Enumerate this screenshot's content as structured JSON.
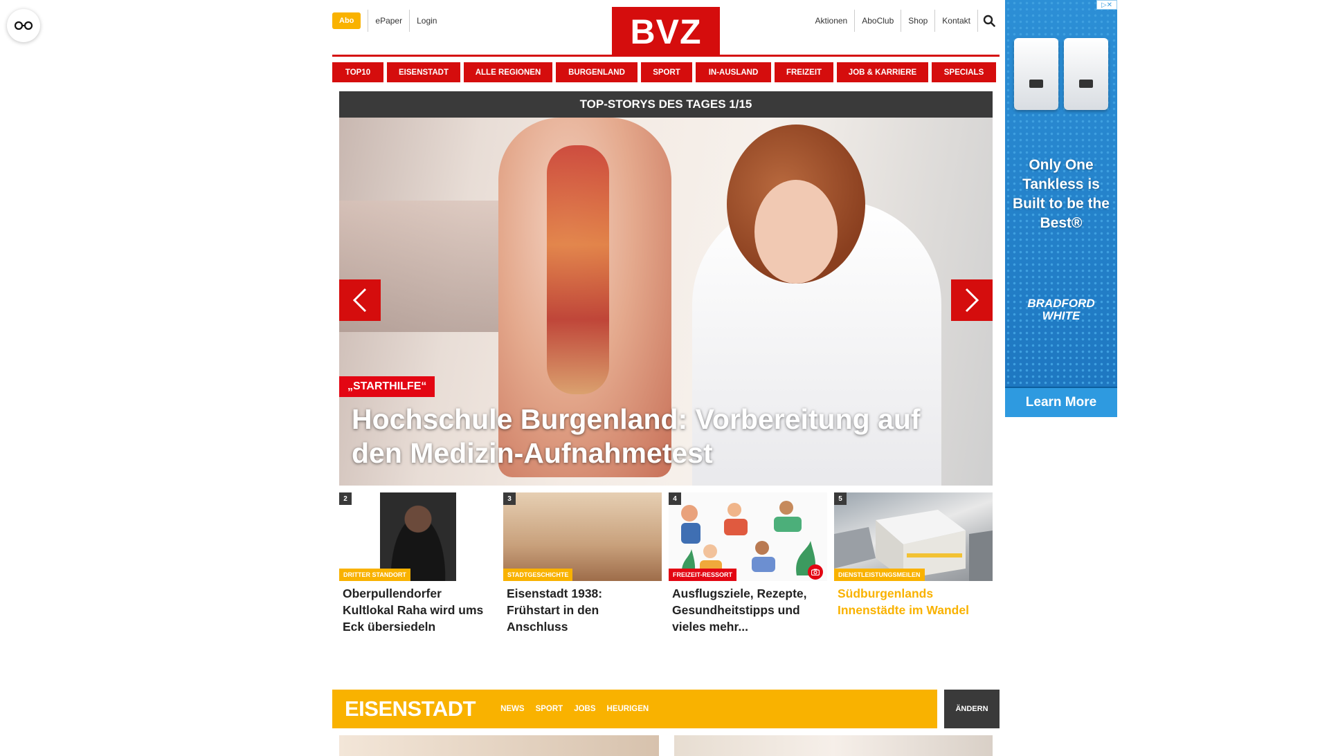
{
  "accessibility": {
    "icon": "glasses-icon"
  },
  "header": {
    "abo": "Abo",
    "left_links": [
      "ePaper",
      "Login"
    ],
    "logo": "BVZ",
    "right_links": [
      "Aktionen",
      "AboClub",
      "Shop",
      "Kontakt"
    ],
    "search_icon": "search-icon"
  },
  "nav": [
    "TOP10",
    "EISENSTADT",
    "ALLE REGIONEN",
    "BURGENLAND",
    "SPORT",
    "IN-AUSLAND",
    "FREIZEIT",
    "JOB & KARRIERE",
    "SPECIALS"
  ],
  "hero": {
    "heading": "TOP-STORYS DES TAGES 1/15",
    "kicker": "„STARTHILFE“",
    "headline": "Hochschule Burgenland: Vorbereitung auf den Medizin-Aufnahmetest"
  },
  "teasers": [
    {
      "num": "2",
      "tag": "DRITTER STANDORT",
      "tag_color": "#f9b200",
      "title": "Oberpullendorfer Kultlokal Raha wird ums Eck übersiedeln"
    },
    {
      "num": "3",
      "tag": "STADTGESCHICHTE",
      "tag_color": "#f9b200",
      "title": "Eisenstadt 1938: Frühstart in den Anschluss"
    },
    {
      "num": "4",
      "tag": "FREIZEIT-RESSORT",
      "tag_color": "#e30613",
      "title": "Ausflugsziele, Rezepte, Gesundheitstipps und vieles mehr..."
    },
    {
      "num": "5",
      "tag": "DIENSTLEISTUNGSMEILEN",
      "tag_color": "#f9b200",
      "title": "Südburgenlands Innenstädte im Wandel"
    }
  ],
  "region": {
    "title": "EISENSTADT",
    "links": [
      "NEWS",
      "SPORT",
      "JOBS",
      "HEURIGEN"
    ],
    "change": "ÄNDERN"
  },
  "ad": {
    "text": "Only One Tankless is Built to be the Best®",
    "brand_line1": "BRADFORD",
    "brand_line2": "WHITE",
    "cta": "Learn More"
  },
  "colors": {
    "brand_red": "#d50d0d",
    "accent_yellow": "#f9b200",
    "dark": "#3a3a3a"
  }
}
